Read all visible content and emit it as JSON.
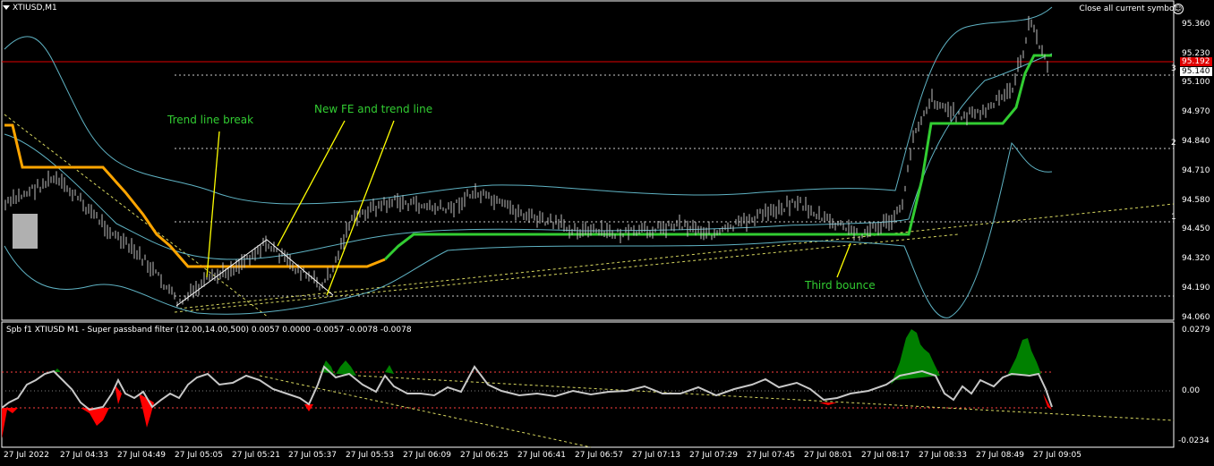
{
  "window": {
    "title": "XTIUSD,M1"
  },
  "toolbar": {
    "close_all_label": "Close all current symbol",
    "smiley_icon": "smiley-icon"
  },
  "annotations": {
    "trend_line_break": "Trend line break",
    "new_fe": "New FE and trend line",
    "third_bounce": "Third bounce"
  },
  "price_axis": {
    "ticks": [
      "95.360",
      "95.230",
      "95.100",
      "94.970",
      "94.840",
      "94.710",
      "94.580",
      "94.450",
      "94.320",
      "94.190",
      "94.060"
    ],
    "level_marks": [
      "3",
      "2",
      "1"
    ],
    "bid_tag": "95.192",
    "current_tag": "95.140"
  },
  "indicator": {
    "title": "Spb f1 XTIUSD M1 - Super passband filter (12.00,14.00,500) 0.0057 0.0000 -0.0057 -0.0078 -0.0078",
    "ticks": [
      "0.0279",
      "0.00",
      "-0.0234"
    ]
  },
  "time_axis": {
    "labels": [
      "27 Jul 2022",
      "27 Jul 04:33",
      "27 Jul 04:49",
      "27 Jul 05:05",
      "27 Jul 05:21",
      "27 Jul 05:37",
      "27 Jul 05:53",
      "27 Jul 06:09",
      "27 Jul 06:25",
      "27 Jul 06:41",
      "27 Jul 06:57",
      "27 Jul 07:13",
      "27 Jul 07:29",
      "27 Jul 07:45",
      "27 Jul 08:01",
      "27 Jul 08:17",
      "27 Jul 08:33",
      "27 Jul 08:49",
      "27 Jul 09:05"
    ]
  },
  "colors": {
    "background": "#000000",
    "candles": "#c0c0c0",
    "bollinger": "#5fb3c4",
    "orange_line": "#ffa500",
    "green_line": "#32cd32",
    "annotation_line": "#ffff00",
    "bid_line": "#e00000",
    "positive_fill": "#008000",
    "negative_fill": "#ff0000"
  }
}
